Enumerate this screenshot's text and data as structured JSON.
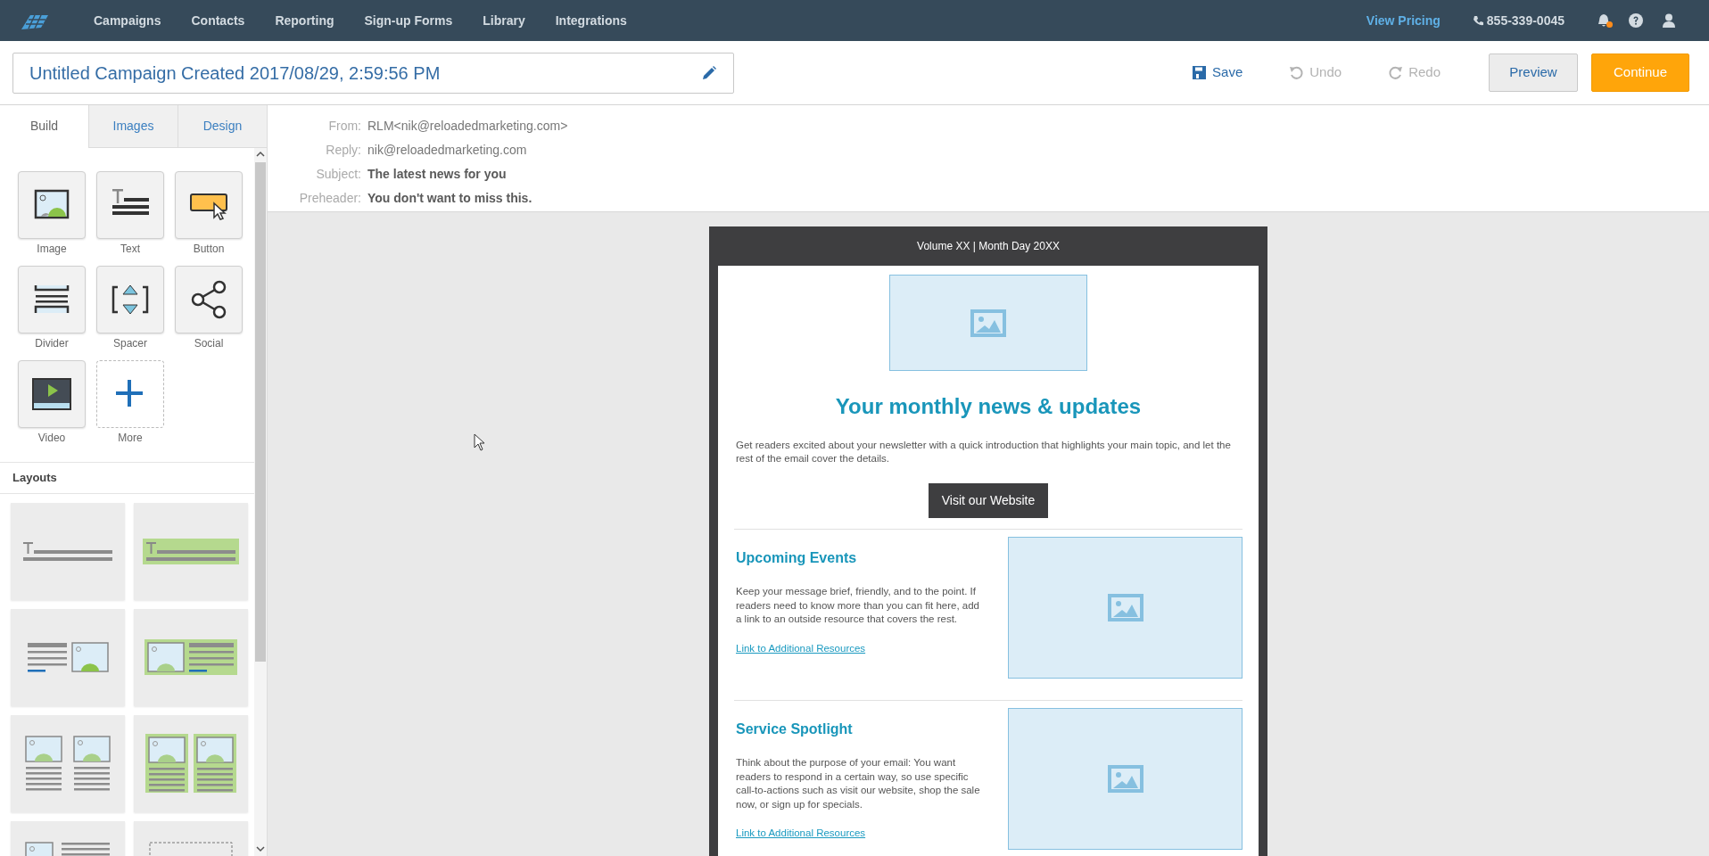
{
  "navbar": {
    "menu": [
      {
        "label": "Campaigns"
      },
      {
        "label": "Contacts"
      },
      {
        "label": "Reporting"
      },
      {
        "label": "Sign-up Forms"
      },
      {
        "label": "Library"
      },
      {
        "label": "Integrations"
      }
    ],
    "pricing_link": "View Pricing",
    "phone": "855-339-0045",
    "notifications": {
      "unread": true
    }
  },
  "toolbar": {
    "campaign_title": "Untitled Campaign Created 2017/08/29, 2:59:56 PM",
    "actions": [
      {
        "kind": "save",
        "label": "Save",
        "disabled": false
      },
      {
        "kind": "undo",
        "label": "Undo",
        "disabled": true
      },
      {
        "kind": "redo",
        "label": "Redo",
        "disabled": true
      }
    ],
    "preview": "Preview",
    "continue": "Continue"
  },
  "sidebar": {
    "tabs": [
      {
        "label": "Build",
        "selected": true
      },
      {
        "label": "Images",
        "selected": false
      },
      {
        "label": "Design",
        "selected": false
      }
    ],
    "blocks": [
      {
        "kind": "image",
        "label": "Image"
      },
      {
        "kind": "text",
        "label": "Text"
      },
      {
        "kind": "button",
        "label": "Button"
      },
      {
        "kind": "divider",
        "label": "Divider"
      },
      {
        "kind": "spacer",
        "label": "Spacer"
      },
      {
        "kind": "social",
        "label": "Social"
      },
      {
        "kind": "video",
        "label": "Video"
      },
      {
        "kind": "more",
        "label": "More"
      }
    ],
    "layouts_title": "Layouts",
    "layouts": [
      {
        "kind": "title-text",
        "filled": false
      },
      {
        "kind": "title-text",
        "filled": true
      },
      {
        "kind": "text-image",
        "filled": false
      },
      {
        "kind": "image-text",
        "filled": true
      },
      {
        "kind": "two-images",
        "filled": false
      },
      {
        "kind": "two-images",
        "filled": true
      },
      {
        "kind": "image-lines",
        "filled": false
      },
      {
        "kind": "dashed",
        "filled": false
      }
    ]
  },
  "header_fields": [
    {
      "label": "From:",
      "value": "RLM<nik@reloadedmarketing.com>",
      "bold": false
    },
    {
      "label": "Reply:",
      "value": "nik@reloadedmarketing.com",
      "bold": false
    },
    {
      "label": "Subject:",
      "value": "The latest news for you",
      "bold": true
    },
    {
      "label": "Preheader:",
      "value": "You don't want to miss this.",
      "bold": true
    }
  ],
  "email": {
    "banner": "Volume XX | Month Day 20XX",
    "headline": "Your monthly news & updates",
    "intro": "Get readers excited about your newsletter with a quick introduction that highlights your main topic, and let the rest of the email cover the details.",
    "cta": "Visit our Website",
    "sections": [
      {
        "title": "Upcoming Events",
        "body": "Keep your message brief, friendly, and to the point. If readers need to know more than you can fit here, add a link to an outside resource that covers the rest.",
        "link": "Link to Additional Resources"
      },
      {
        "title": "Service Spotlight",
        "body": "Think about the purpose of your email: You want readers to respond in a certain way, so use specific call-to-actions such as visit our website, shop the sale now, or sign up for specials.",
        "link": "Link to Additional Resources"
      }
    ]
  }
}
